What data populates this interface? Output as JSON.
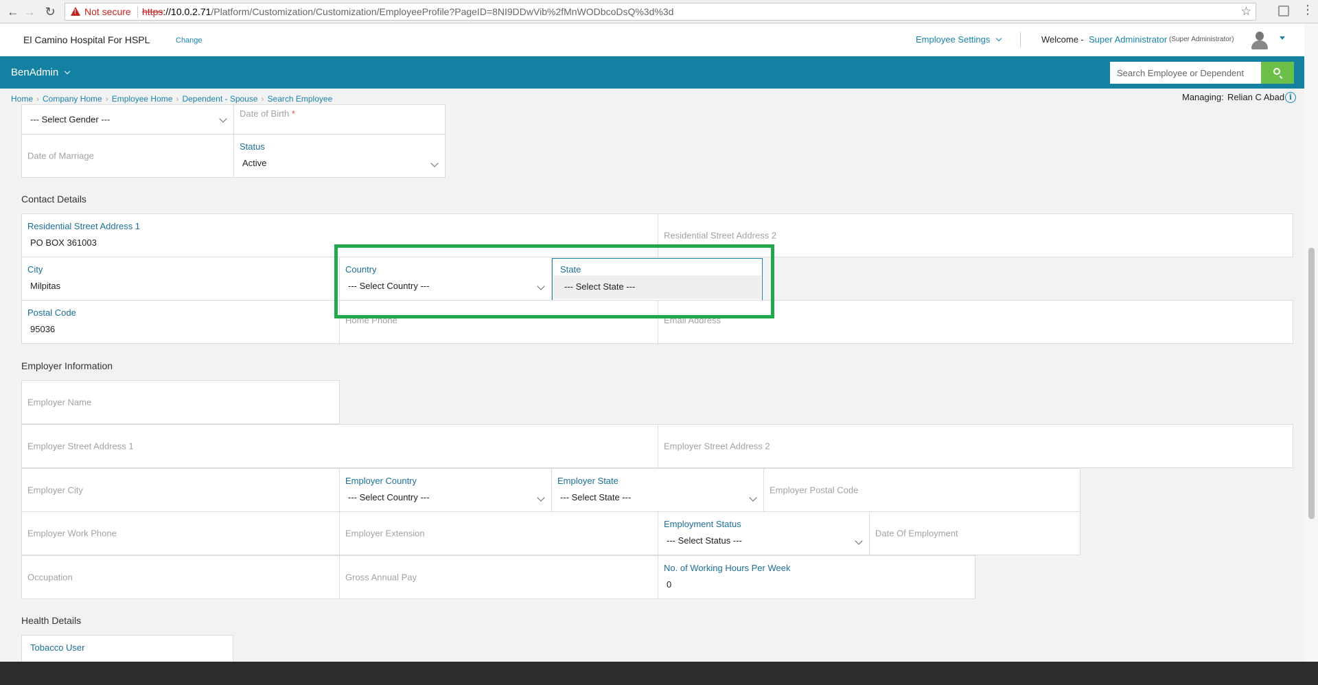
{
  "browser": {
    "security": "Not secure",
    "url_scheme": "https",
    "url_host": "://10.0.2.71",
    "url_path": "/Platform/Customization/Customization/EmployeeProfile?PageID=8NI9DDwVib%2fMnWODbcoDsQ%3d%3d"
  },
  "header": {
    "company": "El Camino Hospital For HSPL",
    "change": "Change",
    "employee_settings": "Employee Settings",
    "welcome": "Welcome -",
    "user": "Super Administrator",
    "role": "(Super Administrator)"
  },
  "topbar": {
    "menu": "BenAdmin",
    "search_placeholder": "Search Employee or Dependent"
  },
  "breadcrumb": [
    "Home",
    "Company Home",
    "Employee Home",
    "Dependent - Spouse",
    "Search Employee"
  ],
  "managing": {
    "label": "Managing:",
    "name": "Relian C Abad"
  },
  "personal": {
    "gender_select": "--- Select Gender ---",
    "dob_placeholder": "Date of Birth",
    "dob_required": "*",
    "marriage_placeholder": "Date of Marriage",
    "status_label": "Status",
    "status_value": "Active"
  },
  "contact": {
    "title": "Contact Details",
    "address1_label": "Residential Street Address 1",
    "address1_value": "PO BOX 361003",
    "address2_placeholder": "Residential Street Address 2",
    "city_label": "City",
    "city_value": "Milpitas",
    "country_label": "Country",
    "country_value": "--- Select Country ---",
    "state_label": "State",
    "state_option": "--- Select State ---",
    "postal_label": "Postal Code",
    "postal_value": "95036",
    "home_phone_placeholder": "Home Phone",
    "email_placeholder": "Email Address"
  },
  "employer": {
    "title": "Employer Information",
    "name_placeholder": "Employer Name",
    "address1_placeholder": "Employer Street Address 1",
    "address2_placeholder": "Employer Street Address 2",
    "city_placeholder": "Employer City",
    "country_label": "Employer Country",
    "country_value": "--- Select Country ---",
    "state_label": "Employer State",
    "state_value": "--- Select State ---",
    "postal_placeholder": "Employer Postal Code",
    "work_phone_placeholder": "Employer Work Phone",
    "extension_placeholder": "Employer Extension",
    "employment_status_label": "Employment Status",
    "employment_status_value": "--- Select Status ---",
    "doe_placeholder": "Date Of Employment",
    "occupation_placeholder": "Occupation",
    "gross_pay_placeholder": "Gross Annual Pay",
    "hours_label": "No. of Working Hours Per Week",
    "hours_value": "0"
  },
  "health": {
    "title": "Health Details",
    "tobacco_label": "Tobacco User"
  },
  "colors": {
    "teal": "#1481a3",
    "link": "#1a82ac",
    "search_green": "#6cc04a",
    "highlight_green": "#22a84a"
  }
}
